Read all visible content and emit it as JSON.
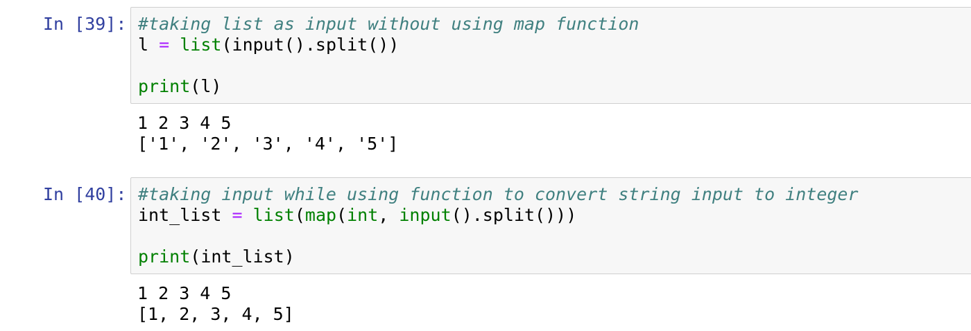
{
  "cells": [
    {
      "prompt": "In [39]:",
      "comment": "#taking list as input without using map function",
      "line1": {
        "var": "l",
        "eq": "=",
        "fn_list": "list",
        "rest": "(input().split())"
      },
      "line3": {
        "fn_print": "print",
        "arg": "(l)"
      },
      "output": [
        "1 2 3 4 5",
        "['1', '2', '3', '4', '5']"
      ]
    },
    {
      "prompt": "In [40]:",
      "comment": "#taking input while using function to convert string input to integer",
      "line1": {
        "var": "int_list",
        "eq": "=",
        "fn_list": "list",
        "p1": "(",
        "fn_map": "map",
        "p2": "(",
        "fn_int": "int",
        "p3": ", ",
        "fn_input": "input",
        "rest": "().split()))"
      },
      "line3": {
        "fn_print": "print",
        "arg": "(int_list)"
      },
      "output": [
        "1 2 3 4 5",
        "[1, 2, 3, 4, 5]"
      ]
    }
  ],
  "colors": {
    "prompt": "#303f9f",
    "comment": "#408080",
    "builtin": "#008000",
    "operator": "#aa22ff",
    "input_bg": "#f7f7f7",
    "input_border": "#cfcfcf"
  }
}
